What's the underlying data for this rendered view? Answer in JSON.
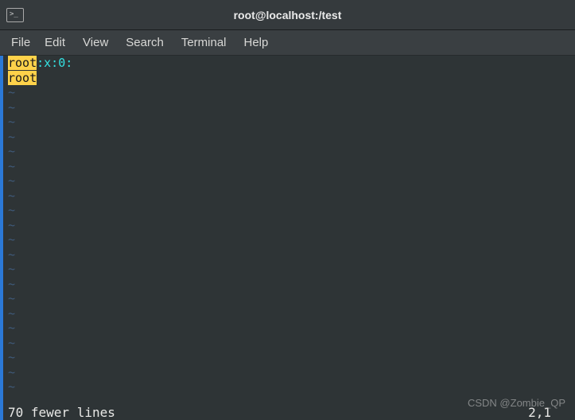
{
  "window": {
    "title": "root@localhost:/test"
  },
  "menubar": {
    "items": [
      "File",
      "Edit",
      "View",
      "Search",
      "Terminal",
      "Help"
    ]
  },
  "editor": {
    "line1_hl": "root",
    "line1_rest": ":x:0:",
    "line2_hl": "root",
    "tilde": "~",
    "tilde_count": 21,
    "status_message": "70 fewer lines",
    "position": "2,1"
  },
  "watermark": "CSDN @Zombie_QP"
}
